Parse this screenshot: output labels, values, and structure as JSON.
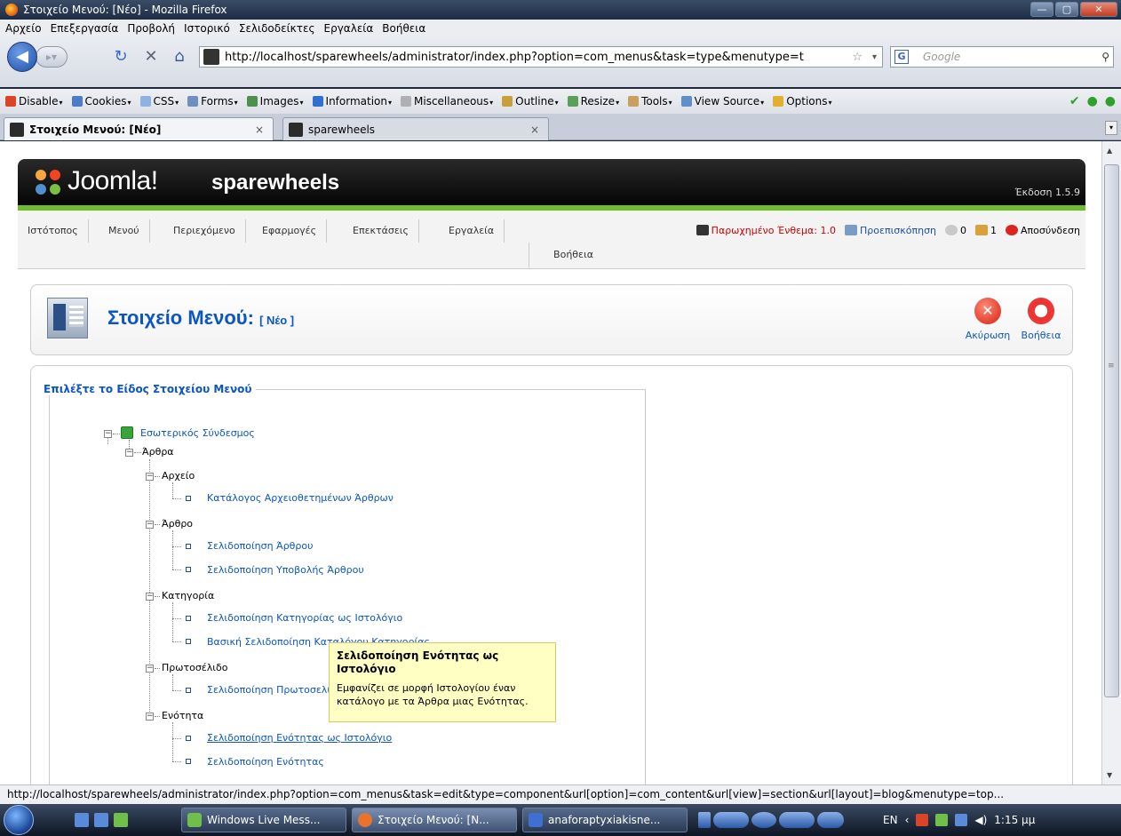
{
  "window": {
    "title": "Στοιχείο Μενού: [Νέο] - Mozilla Firefox",
    "controls": [
      "—",
      "▢",
      "✕"
    ]
  },
  "menubar": [
    "Αρχείο",
    "Επεξεργασία",
    "Προβολή",
    "Ιστορικό",
    "Σελιδοδείκτες",
    "Εργαλεία",
    "Βοήθεια"
  ],
  "navbar": {
    "url": "http://localhost/sparewheels/administrator/index.php?option=com_menus&task=type&menutype=t",
    "search_placeholder": "Google"
  },
  "devbar": {
    "items": [
      {
        "label": "Disable",
        "color": "#d9442a"
      },
      {
        "label": "Cookies",
        "color": "#4a7cc9"
      },
      {
        "label": "CSS",
        "color": "#8fb3e0"
      },
      {
        "label": "Forms",
        "color": "#6f8fc0"
      },
      {
        "label": "Images",
        "color": "#4f8f4f"
      },
      {
        "label": "Information",
        "color": "#2f6fd0"
      },
      {
        "label": "Miscellaneous",
        "color": "#b0b0b0"
      },
      {
        "label": "Outline",
        "color": "#c8a03a"
      },
      {
        "label": "Resize",
        "color": "#5aa05a"
      },
      {
        "label": "Tools",
        "color": "#c9a060"
      },
      {
        "label": "View Source",
        "color": "#5f8fc9"
      },
      {
        "label": "Options",
        "color": "#e0b030"
      }
    ]
  },
  "tabs": [
    {
      "label": "Στοιχείο Μενού: [Νέο]",
      "active": true
    },
    {
      "label": "sparewheels",
      "active": false
    }
  ],
  "joomla": {
    "brand": "Joomla!",
    "site": "sparewheels",
    "version": "Έκδοση 1.5.9",
    "menu": [
      "Ιστότοπος",
      "Μενού",
      "Περιεχόμενο",
      "Εφαρμογές",
      "Επεκτάσεις",
      "Εργαλεία"
    ],
    "menu_help": "Βοήθεια",
    "status": {
      "legacy": "Παρωχημένο Ένθεμα: 1.0",
      "preview": "Προεπισκόπηση",
      "messages": "0",
      "users": "1",
      "logout": "Αποσύνδεση"
    }
  },
  "toolbar": {
    "title": "Στοιχείο Μενού:",
    "subtitle": "[ Νέο ]",
    "cancel": "Ακύρωση",
    "help": "Βοήθεια"
  },
  "tree": {
    "legend": "Επιλέξτε το Είδος Στοιχείου Μενού",
    "root": "Εσωτερικός Σύνδεσμος",
    "articles": "Άρθρα",
    "groups": [
      {
        "label": "Αρχείο",
        "items": [
          "Κατάλογος Αρχειοθετημένων Άρθρων"
        ]
      },
      {
        "label": "Άρθρο",
        "items": [
          "Σελιδοποίηση Άρθρου",
          "Σελιδοποίηση Υποβολής Άρθρου"
        ]
      },
      {
        "label": "Κατηγορία",
        "items": [
          "Σελιδοποίηση Κατηγορίας ως Ιστολόγιο",
          "Βασική Σελιδοποίηση Καταλόγου Κατηγορίας"
        ]
      },
      {
        "label": "Πρωτοσέλιδο",
        "items": [
          "Σελιδοποίηση Πρωτοσελίδου ως Ιστολόγιο"
        ]
      },
      {
        "label": "Ενότητα",
        "items": [
          "Σελιδοποίηση Ενότητας ως Ιστολόγιο",
          "Σελιδοποίηση Ενότητας"
        ]
      }
    ]
  },
  "tooltip": {
    "title": "Σελιδοποίηση Ενότητας ως Ιστολόγιο",
    "body": "Εμφανίζει σε μορφή Ιστολογίου έναν κατάλογο με τα Άρθρα μιας Ενότητας."
  },
  "statusbar": "http://localhost/sparewheels/administrator/index.php?option=com_menus&task=edit&type=component&url[option]=com_content&url[view]=section&url[layout]=blog&menutype=top...",
  "taskbar": {
    "tasks": [
      "Windows Live Mess...",
      "Στοιχείο Μενού: [N...",
      "anaforaptyxiakisne..."
    ],
    "lang": "EN",
    "time": "1:15 μμ"
  }
}
